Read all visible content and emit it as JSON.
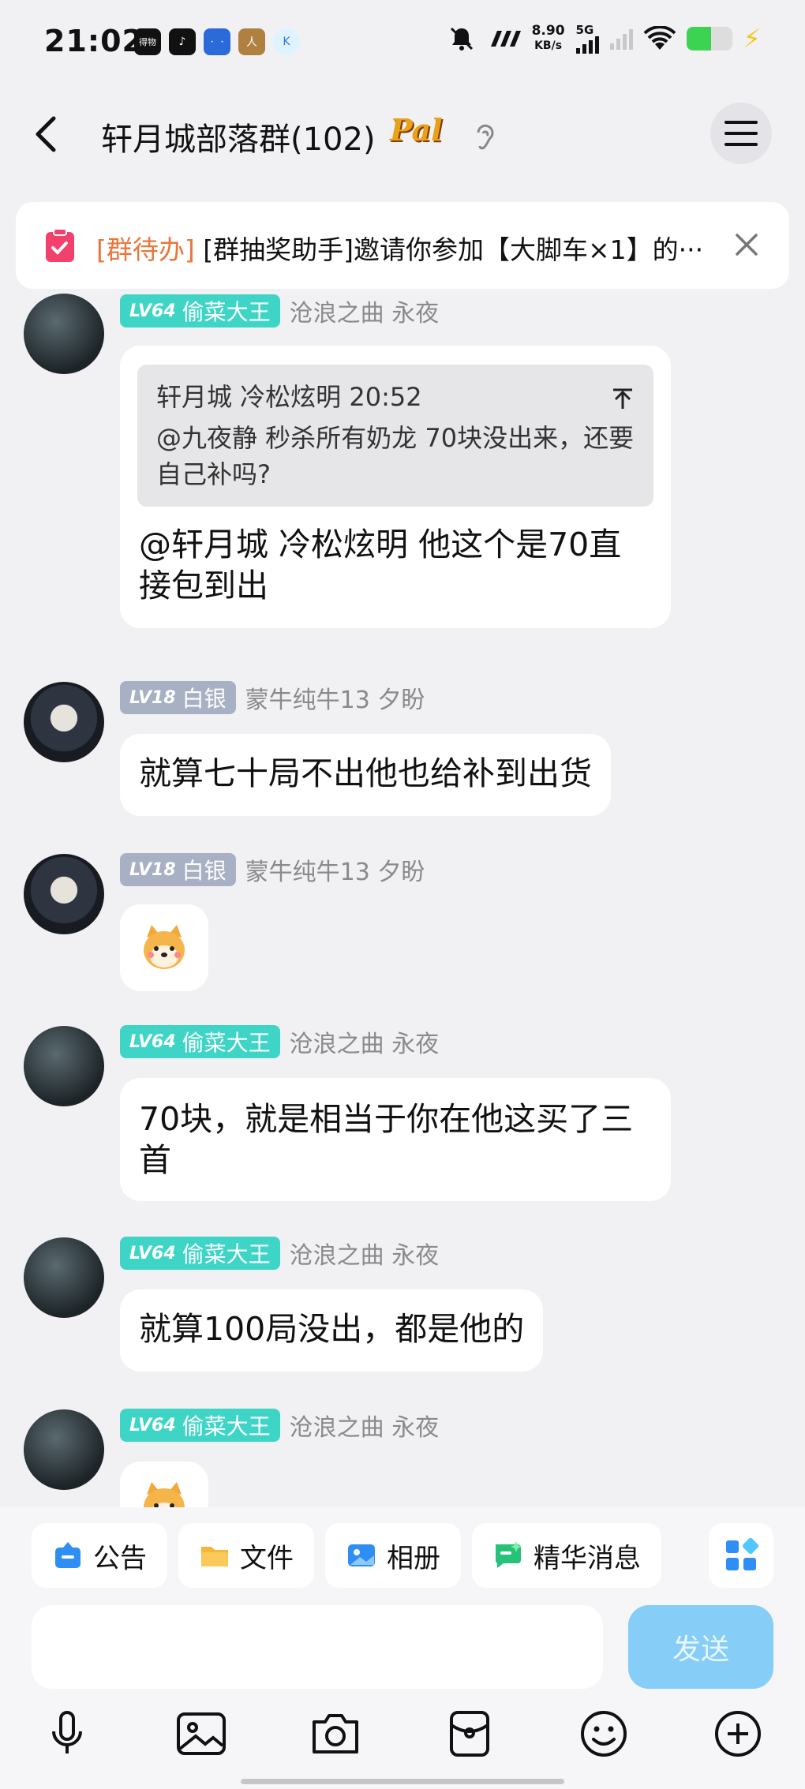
{
  "status_bar": {
    "time": "21:02",
    "app_icons": [
      "得物",
      "♪",
      "ㆍㆍ",
      "人",
      "K"
    ],
    "speed_value": "8.90",
    "speed_unit": "KB/s",
    "network": "5G",
    "battery_level": 0.55
  },
  "header": {
    "title": "轩月城部落群(102)",
    "badge": "Pal"
  },
  "todo": {
    "tag": "[群待办]",
    "text": "[群抽奖助手]邀请你参加【大脚车×1】的···"
  },
  "messages": [
    {
      "level": "LV64",
      "title": "偷菜大王",
      "nick": "沧浪之曲 永夜",
      "quote_head": "轩月城  冷松炫明 20:52",
      "quote_body": "@九夜静  秒杀所有奶龙 70块没出来，还要自己补吗?",
      "text": "@轩月城  冷松炫明 他这个是70直接包到出"
    },
    {
      "level": "LV18",
      "title": "白银",
      "nick": "蒙牛纯牛13  夕盼",
      "text": "就算七十局不出他也给补到出货"
    },
    {
      "level": "LV18",
      "title": "白银",
      "nick": "蒙牛纯牛13  夕盼",
      "text": ""
    },
    {
      "level": "LV64",
      "title": "偷菜大王",
      "nick": "沧浪之曲 永夜",
      "text": "70块，就是相当于你在他这买了三首"
    },
    {
      "level": "LV64",
      "title": "偷菜大王",
      "nick": "沧浪之曲 永夜",
      "text": "就算100局没出，都是他的"
    },
    {
      "level": "LV64",
      "title": "偷菜大王",
      "nick": "沧浪之曲 永夜",
      "text": ""
    }
  ],
  "quick_actions": {
    "announcement": "公告",
    "files": "文件",
    "album": "相册",
    "essence": "精华消息"
  },
  "composer": {
    "placeholder": "",
    "send_label": "发送"
  },
  "colors": {
    "teal_badge": "#3fd5c6",
    "gray_badge": "#a8b0c4",
    "send_button": "#86cdf8",
    "todo_tag": "#e9773d"
  }
}
